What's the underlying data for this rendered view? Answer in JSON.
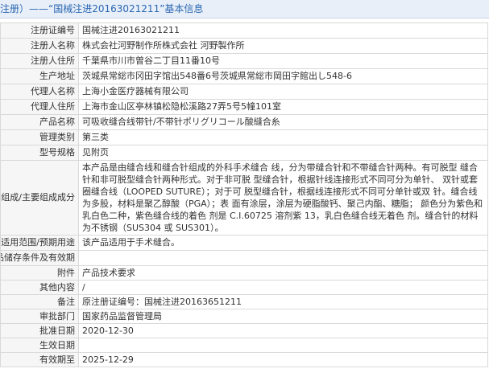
{
  "header": {
    "title": "注册）——“国械注进20163021211”基本信息"
  },
  "rows": [
    {
      "label": "注册证编号",
      "value": "国械注进20163021211"
    },
    {
      "label": "注册人名称",
      "value": "株式会社河野制作所株式会社 河野製作所"
    },
    {
      "label": "注册人住所",
      "value": "千葉県市川市曽谷二丁目11番10号"
    },
    {
      "label": "生产地址",
      "value": "茨城県常総市冈田字馆出548番6号茨城県常総市岡田字館出し548-6"
    },
    {
      "label": "代理人名称",
      "value": "上海小金医疗器械有限公司"
    },
    {
      "label": "代理人住所",
      "value": "上海市金山区亭林镇松隐松溪路27弄5号5幢101室"
    },
    {
      "label": "产品名称",
      "value": "可吸收缝合线带针/不带针ポリグリコール酸縫合糸"
    },
    {
      "label": "管理类别",
      "value": "第三类"
    },
    {
      "label": "型号规格",
      "value": "见附页"
    },
    {
      "label": "结构及组成/主要组成成分",
      "value": "本产品是由缝合线和缝合针组成的外科手术缝合 线，分为带缝合针和不带缝合针两种。有可脱型 缝合针和非可脱型缝合针两种形式。对于非可脱 型缝合针，根据针线连接形式不同可分为单针、 双针或套圈缝合线（LOOPED SUTURE）；对于可 脱型缝合针，根据线连接形式不同可分单针或双 针。缝合线为多股，材料是聚乙醇酸（PGA）；表 面有涂层，涂层为硬脂酸钙、聚己内酯、糖脂； 颜色分为紫色和乳白色二种，紫色缝合线的着色 剂是 C.I.60725 溶剂紫 13，乳白色缝合线无着色 剂。缝合针的材料为不锈钢（SUS304 或 SUS301）。"
    },
    {
      "label": "适用范围/预期用途",
      "value": "该产品适用于手术缝合。"
    },
    {
      "label": "产品储存条件及有效期",
      "value": ""
    },
    {
      "label": "附件",
      "value": "产品技术要求"
    },
    {
      "label": "其他内容",
      "value": "/"
    },
    {
      "label": "备注",
      "value": "原注册证编号：国械注进20163651211"
    },
    {
      "label": "审批部门",
      "value": "国家药品监督管理局"
    },
    {
      "label": "批准日期",
      "value": "2020-12-30"
    },
    {
      "label": "生效日期",
      "value": ""
    },
    {
      "label": "有效期至",
      "value": "2025-12-29"
    }
  ]
}
